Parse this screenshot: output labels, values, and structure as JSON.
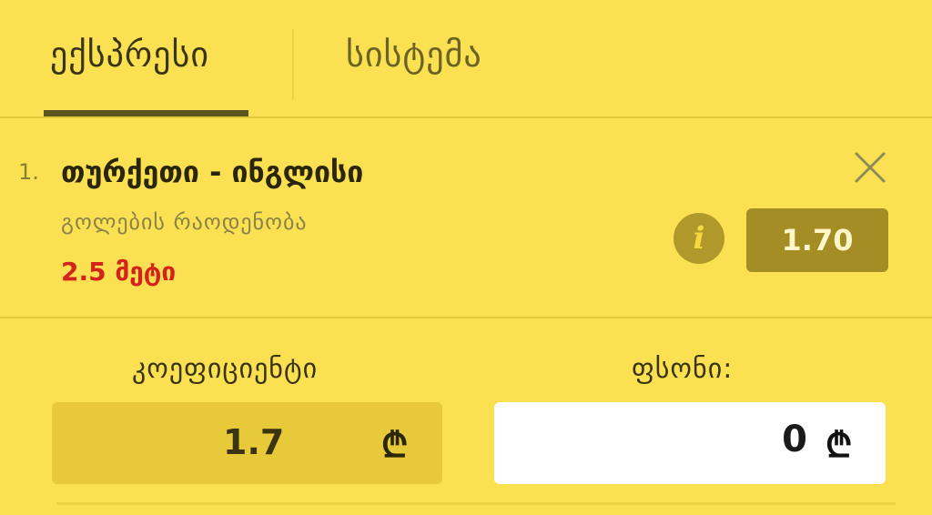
{
  "tabs": [
    {
      "label": "ექსპრესი",
      "active": true
    },
    {
      "label": "სისტემა",
      "active": false
    }
  ],
  "bet": {
    "index": "1.",
    "match": "თურქეთი - ინგლისი",
    "market": "გოლების რაოდენობა",
    "selection": "2.5 მეტი",
    "odds": "1.70",
    "info_icon": "info-icon",
    "close_icon": "close-icon"
  },
  "summary": {
    "coefficient_label": "კოეფიციენტი",
    "coefficient_value": "1.7",
    "stake_label": "ფსონი:",
    "stake_value": "0",
    "currency_symbol": "₾"
  },
  "colors": {
    "background": "#fbe052",
    "accent_dark": "#5c5520",
    "selection_red": "#d3231c",
    "odds_badge": "#a48d25"
  }
}
